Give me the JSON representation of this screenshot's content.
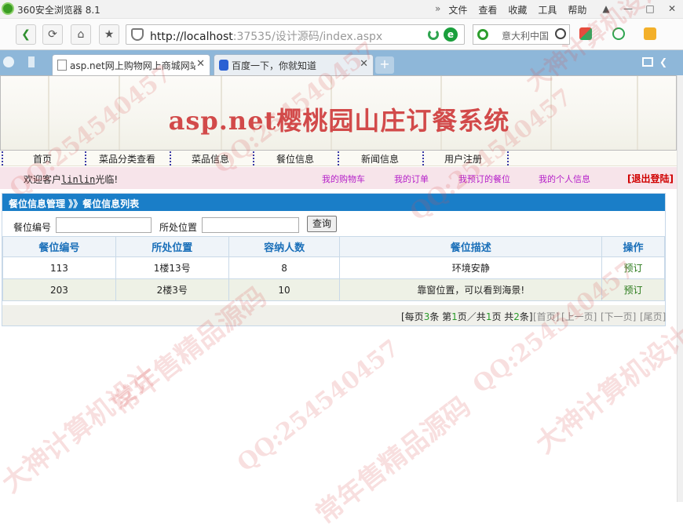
{
  "window": {
    "title": "360安全浏览器 8.1"
  },
  "menu": {
    "items": [
      "文件",
      "查看",
      "收藏",
      "工具",
      "帮助"
    ]
  },
  "address": {
    "host": "http://localhost",
    "rest": ":37535/设计源码/index.aspx"
  },
  "search": {
    "placeholder": "意大利中国"
  },
  "tabs": [
    {
      "label": "asp.net网上购物网上商城网站"
    },
    {
      "label": "百度一下，你就知道"
    }
  ],
  "site": {
    "title": "asp.net樱桃园山庄订餐系统"
  },
  "nav": {
    "items": [
      "首页",
      "菜品分类查看",
      "菜品信息",
      "餐位信息",
      "新闻信息",
      "用户注册"
    ]
  },
  "user": {
    "welcome_prefix": "欢迎客户",
    "name": "linlin",
    "welcome_suffix": "光临!",
    "links": [
      "我的购物车",
      "我的订单",
      "我预订的餐位",
      "我的个人信息"
    ],
    "logout": "[退出登陆]"
  },
  "panel": {
    "breadcrumb": "餐位信息管理  》》餐位信息列表",
    "filter": {
      "seat_no_label": "餐位编号",
      "location_label": "所处位置",
      "search_button": "查询"
    },
    "columns": [
      "餐位编号",
      "所处位置",
      "容纳人数",
      "餐位描述",
      "操作"
    ],
    "rows": [
      {
        "no": "113",
        "location": "1楼13号",
        "capacity": "8",
        "desc": "环境安静",
        "action": "预订"
      },
      {
        "no": "203",
        "location": "2楼3号",
        "capacity": "10",
        "desc": "靠窗位置，可以看到海景!",
        "action": "预订"
      }
    ],
    "pager": {
      "per_page_prefix": "[每页",
      "per_page": "3",
      "per_page_suffix": "条 第",
      "current": "1",
      "mid": "页／共",
      "total_pages": "1",
      "mid2": "页 共",
      "total": "2",
      "end": "条]",
      "first": "[首页]",
      "prev": "[上一页]",
      "next": "[下一页]",
      "last": "[尾页]"
    }
  },
  "watermarks": [
    "QQ:254540457",
    "大神计算机设计",
    "常年售精品源码"
  ]
}
